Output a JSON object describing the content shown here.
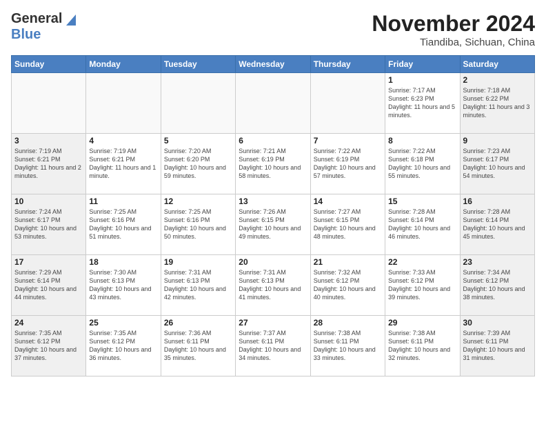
{
  "header": {
    "logo_general": "General",
    "logo_blue": "Blue",
    "title": "November 2024",
    "subtitle": "Tiandiba, Sichuan, China"
  },
  "days_of_week": [
    "Sunday",
    "Monday",
    "Tuesday",
    "Wednesday",
    "Thursday",
    "Friday",
    "Saturday"
  ],
  "weeks": [
    [
      {
        "day": "",
        "info": "",
        "type": "empty"
      },
      {
        "day": "",
        "info": "",
        "type": "empty"
      },
      {
        "day": "",
        "info": "",
        "type": "empty"
      },
      {
        "day": "",
        "info": "",
        "type": "empty"
      },
      {
        "day": "",
        "info": "",
        "type": "empty"
      },
      {
        "day": "1",
        "info": "Sunrise: 7:17 AM\nSunset: 6:23 PM\nDaylight: 11 hours and 5 minutes.",
        "type": "weekday"
      },
      {
        "day": "2",
        "info": "Sunrise: 7:18 AM\nSunset: 6:22 PM\nDaylight: 11 hours and 3 minutes.",
        "type": "weekend"
      }
    ],
    [
      {
        "day": "3",
        "info": "Sunrise: 7:19 AM\nSunset: 6:21 PM\nDaylight: 11 hours and 2 minutes.",
        "type": "weekend"
      },
      {
        "day": "4",
        "info": "Sunrise: 7:19 AM\nSunset: 6:21 PM\nDaylight: 11 hours and 1 minute.",
        "type": "weekday"
      },
      {
        "day": "5",
        "info": "Sunrise: 7:20 AM\nSunset: 6:20 PM\nDaylight: 10 hours and 59 minutes.",
        "type": "weekday"
      },
      {
        "day": "6",
        "info": "Sunrise: 7:21 AM\nSunset: 6:19 PM\nDaylight: 10 hours and 58 minutes.",
        "type": "weekday"
      },
      {
        "day": "7",
        "info": "Sunrise: 7:22 AM\nSunset: 6:19 PM\nDaylight: 10 hours and 57 minutes.",
        "type": "weekday"
      },
      {
        "day": "8",
        "info": "Sunrise: 7:22 AM\nSunset: 6:18 PM\nDaylight: 10 hours and 55 minutes.",
        "type": "weekday"
      },
      {
        "day": "9",
        "info": "Sunrise: 7:23 AM\nSunset: 6:17 PM\nDaylight: 10 hours and 54 minutes.",
        "type": "weekend"
      }
    ],
    [
      {
        "day": "10",
        "info": "Sunrise: 7:24 AM\nSunset: 6:17 PM\nDaylight: 10 hours and 53 minutes.",
        "type": "weekend"
      },
      {
        "day": "11",
        "info": "Sunrise: 7:25 AM\nSunset: 6:16 PM\nDaylight: 10 hours and 51 minutes.",
        "type": "weekday"
      },
      {
        "day": "12",
        "info": "Sunrise: 7:25 AM\nSunset: 6:16 PM\nDaylight: 10 hours and 50 minutes.",
        "type": "weekday"
      },
      {
        "day": "13",
        "info": "Sunrise: 7:26 AM\nSunset: 6:15 PM\nDaylight: 10 hours and 49 minutes.",
        "type": "weekday"
      },
      {
        "day": "14",
        "info": "Sunrise: 7:27 AM\nSunset: 6:15 PM\nDaylight: 10 hours and 48 minutes.",
        "type": "weekday"
      },
      {
        "day": "15",
        "info": "Sunrise: 7:28 AM\nSunset: 6:14 PM\nDaylight: 10 hours and 46 minutes.",
        "type": "weekday"
      },
      {
        "day": "16",
        "info": "Sunrise: 7:28 AM\nSunset: 6:14 PM\nDaylight: 10 hours and 45 minutes.",
        "type": "weekend"
      }
    ],
    [
      {
        "day": "17",
        "info": "Sunrise: 7:29 AM\nSunset: 6:14 PM\nDaylight: 10 hours and 44 minutes.",
        "type": "weekend"
      },
      {
        "day": "18",
        "info": "Sunrise: 7:30 AM\nSunset: 6:13 PM\nDaylight: 10 hours and 43 minutes.",
        "type": "weekday"
      },
      {
        "day": "19",
        "info": "Sunrise: 7:31 AM\nSunset: 6:13 PM\nDaylight: 10 hours and 42 minutes.",
        "type": "weekday"
      },
      {
        "day": "20",
        "info": "Sunrise: 7:31 AM\nSunset: 6:13 PM\nDaylight: 10 hours and 41 minutes.",
        "type": "weekday"
      },
      {
        "day": "21",
        "info": "Sunrise: 7:32 AM\nSunset: 6:12 PM\nDaylight: 10 hours and 40 minutes.",
        "type": "weekday"
      },
      {
        "day": "22",
        "info": "Sunrise: 7:33 AM\nSunset: 6:12 PM\nDaylight: 10 hours and 39 minutes.",
        "type": "weekday"
      },
      {
        "day": "23",
        "info": "Sunrise: 7:34 AM\nSunset: 6:12 PM\nDaylight: 10 hours and 38 minutes.",
        "type": "weekend"
      }
    ],
    [
      {
        "day": "24",
        "info": "Sunrise: 7:35 AM\nSunset: 6:12 PM\nDaylight: 10 hours and 37 minutes.",
        "type": "weekend"
      },
      {
        "day": "25",
        "info": "Sunrise: 7:35 AM\nSunset: 6:12 PM\nDaylight: 10 hours and 36 minutes.",
        "type": "weekday"
      },
      {
        "day": "26",
        "info": "Sunrise: 7:36 AM\nSunset: 6:11 PM\nDaylight: 10 hours and 35 minutes.",
        "type": "weekday"
      },
      {
        "day": "27",
        "info": "Sunrise: 7:37 AM\nSunset: 6:11 PM\nDaylight: 10 hours and 34 minutes.",
        "type": "weekday"
      },
      {
        "day": "28",
        "info": "Sunrise: 7:38 AM\nSunset: 6:11 PM\nDaylight: 10 hours and 33 minutes.",
        "type": "weekday"
      },
      {
        "day": "29",
        "info": "Sunrise: 7:38 AM\nSunset: 6:11 PM\nDaylight: 10 hours and 32 minutes.",
        "type": "weekday"
      },
      {
        "day": "30",
        "info": "Sunrise: 7:39 AM\nSunset: 6:11 PM\nDaylight: 10 hours and 31 minutes.",
        "type": "weekend"
      }
    ]
  ]
}
